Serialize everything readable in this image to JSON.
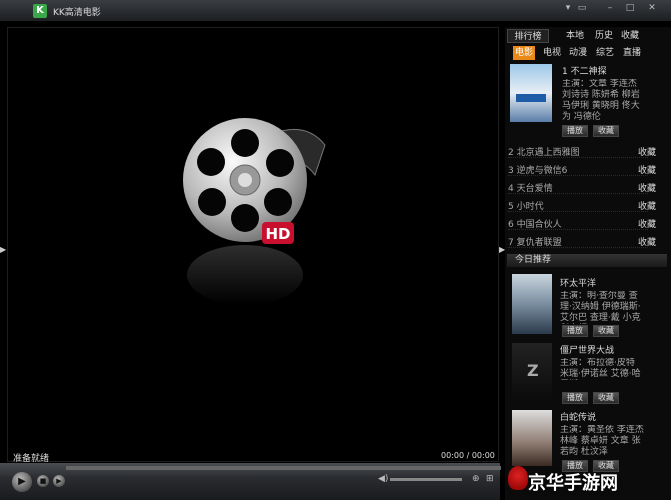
{
  "titlebar": {
    "logo": "K",
    "title": "KK高清电影"
  },
  "player": {
    "status": "准备就绪",
    "time": "00:00 / 00:00",
    "hd_badge": "HD"
  },
  "sidebar": {
    "tabs": [
      "排行榜",
      "本地",
      "历史",
      "收藏"
    ],
    "categories": [
      "电影",
      "电视",
      "动漫",
      "综艺",
      "直播"
    ],
    "featured": {
      "title": "1 不二神探",
      "cast": "主演：文章 李连杰 刘诗诗 陈妍希 柳岩 马伊琍 黄晓明 佟大为 冯德伦",
      "play": "播放",
      "fav": "收藏"
    },
    "ranking": [
      {
        "title": "2 北京遇上西雅图",
        "fav": "收藏"
      },
      {
        "title": "3 逆虎与微信6",
        "fav": "收藏"
      },
      {
        "title": "4 天台爱情",
        "fav": "收藏"
      },
      {
        "title": "5 小时代",
        "fav": "收藏"
      },
      {
        "title": "6 中国合伙人",
        "fav": "收藏"
      },
      {
        "title": "7 复仇者联盟",
        "fav": "收藏"
      }
    ],
    "today_header": "今日推荐",
    "today": [
      {
        "title": "环太平洋",
        "cast": "主演：明·查尔曼 查理·汉纳姆 伊德瑞斯·艾尔巴 查理·戴 小克利夫顿",
        "play": "播放",
        "fav": "收藏"
      },
      {
        "title": "僵尸世界大战",
        "cast": "主演：布拉德·皮特 米瑞·伊诺丝 艾德·哈里斯",
        "play": "播放",
        "fav": "收藏"
      },
      {
        "title": "白蛇传说",
        "cast": "主演：黄圣依 李连杰 林峰 蔡卓妍 文章 张若昀 杜汶泽",
        "play": "播放",
        "fav": "收藏"
      }
    ]
  },
  "watermark": "京华手游网",
  "colors": {
    "accent": "#e8891a",
    "logo": "#3aa64a"
  }
}
